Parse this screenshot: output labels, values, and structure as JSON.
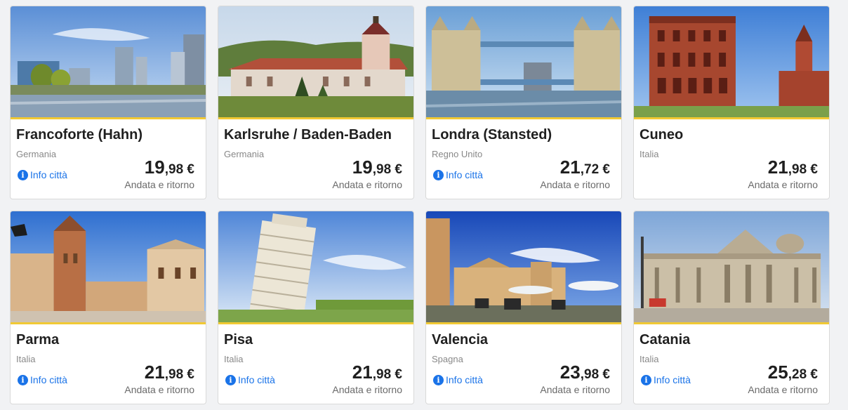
{
  "colors": {
    "accent": "#f1c933",
    "link": "#1a73e8"
  },
  "destinations": [
    {
      "name": "Francoforte (Hahn)",
      "country": "Germania",
      "info_link": "Info città",
      "price_int": "19",
      "price_dec": ",98",
      "currency": " €",
      "trip_type": "Andata e ritorno",
      "image": "frankfurt-skyline-river"
    },
    {
      "name": "Karlsruhe / Baden-Baden",
      "country": "Germania",
      "info_link": "",
      "price_int": "19",
      "price_dec": ",98",
      "currency": " €",
      "trip_type": "Andata e ritorno",
      "image": "baden-baden-church"
    },
    {
      "name": "Londra (Stansted)",
      "country": "Regno Unito",
      "info_link": "Info città",
      "price_int": "21",
      "price_dec": ",72",
      "currency": " €",
      "trip_type": "Andata e ritorno",
      "image": "tower-bridge"
    },
    {
      "name": "Cuneo",
      "country": "Italia",
      "info_link": "",
      "price_int": "21",
      "price_dec": ",98",
      "currency": " €",
      "trip_type": "Andata e ritorno",
      "image": "cuneo-red-palace"
    },
    {
      "name": "Parma",
      "country": "Italia",
      "info_link": "Info città",
      "price_int": "21",
      "price_dec": ",98",
      "currency": " €",
      "trip_type": "Andata e ritorno",
      "image": "parma-cathedral-square"
    },
    {
      "name": "Pisa",
      "country": "Italia",
      "info_link": "Info città",
      "price_int": "21",
      "price_dec": ",98",
      "currency": " €",
      "trip_type": "Andata e ritorno",
      "image": "leaning-tower"
    },
    {
      "name": "Valencia",
      "country": "Spagna",
      "info_link": "Info città",
      "price_int": "23",
      "price_dec": ",98",
      "currency": " €",
      "trip_type": "Andata e ritorno",
      "image": "valencia-plaza"
    },
    {
      "name": "Catania",
      "country": "Italia",
      "info_link": "Info città",
      "price_int": "25",
      "price_dec": ",28",
      "currency": " €",
      "trip_type": "Andata e ritorno",
      "image": "catania-cathedral"
    }
  ]
}
